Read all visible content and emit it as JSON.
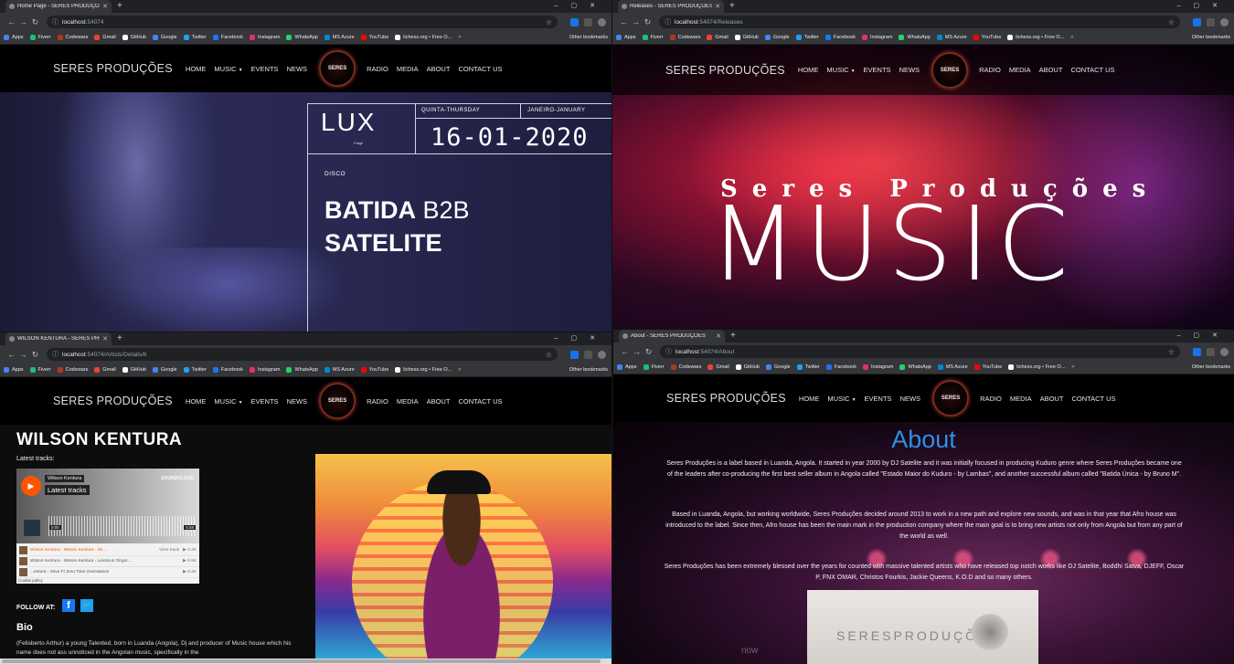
{
  "bookmarks": {
    "items": [
      "Apps",
      "Fiverr",
      "Codewars",
      "Gmail",
      "GitHub",
      "Google",
      "Twitter",
      "Facebook",
      "Instagram",
      "WhatsApp",
      "MS Azure",
      "YouTube",
      "lichess.org • Free O..."
    ],
    "overflow": "»",
    "other": "Other bookmarks",
    "colors": [
      "#4285f4",
      "#1dbf73",
      "#b1361e",
      "#ea4335",
      "#ffffff",
      "#4285f4",
      "#1da1f2",
      "#1877f2",
      "#e1306c",
      "#25d366",
      "#0089d6",
      "#ff0000",
      "#ffffff"
    ]
  },
  "site": {
    "brand": "SERES PRODUÇÕES",
    "nav_left": [
      "HOME",
      "MUSIC",
      "EVENTS",
      "NEWS"
    ],
    "nav_right": [
      "RADIO",
      "MEDIA",
      "ABOUT",
      "CONTACT US"
    ],
    "logo_text": "SERES"
  },
  "windows": {
    "home": {
      "tab_title": "Home Page - SERES PRODUÇÕES",
      "url_host": "localhost",
      "url_path": ":54074",
      "poster": {
        "venue": "LUX",
        "venue_sub": "Fragil",
        "weekday": "QUINTA-THURSDAY",
        "month": "JANEIRO-JANUARY",
        "date": "16-01-2020",
        "genre": "DISCO",
        "line1_a": "BATIDA",
        "line1_b": " B2B",
        "line2": "SATELITE"
      }
    },
    "releases": {
      "tab_title": "Releases - SERES PRODUÇÕES",
      "url_host": "localhost",
      "url_path": ":54074/Releases",
      "script_title": "Seres Produções",
      "big_title": "MUSIC"
    },
    "artist": {
      "tab_title": "WILSON KENTURA - SERES PRODUÇÕES",
      "url_host": "localhost",
      "url_path": ":54074/Artists/Details/6",
      "name": "WILSON KENTURA",
      "latest_label": "Latest tracks:",
      "soundcloud": {
        "artist": "Wilson Kentura",
        "title": "Latest tracks",
        "brand": "SOUNDCLOUD",
        "time_start": "0:00",
        "time_end": "5:58",
        "tracks": [
          {
            "name": "Wilson Kentura - Wilson Kentura - Wi...",
            "action": "View track",
            "plays": "2.2K"
          },
          {
            "name": "Wilson Kentura - Wilson Kentura - Leviticus Origin...",
            "action": "",
            "plays": "8.9K"
          },
          {
            "name": "...entura - Silva Ft Zero Toke Overalation",
            "action": "",
            "plays": "8.3K"
          }
        ],
        "cookie": "Cookie policy"
      },
      "follow_label": "FOLLOW AT:",
      "bio_title": "Bio",
      "bio_text": "(Felisberto Arthur) a young Talented, born in Luanda (Angola), Dj and producer of Music house which his name does not ass unnoticed in the Angolan music, specifically in the"
    },
    "about": {
      "tab_title": "About - SERES PRODUÇÕES",
      "url_host": "localhost",
      "url_path": ":54074/About",
      "title": "About",
      "paragraphs": [
        "Seres Produções is a label based in Luanda, Angola. It started in year 2000 by DJ Satelite and it was initially focused in producing Kuduro genre where Seres Produções became one of the leaders after co-producing the first best seller album in Angola called \"Estado Maior do Kuduro - by Lambas\", and another successful album called \"Batida Única - by Bruno M\".",
        "Based in Luanda, Angola, but working worldwide, Seres Produções decided around 2013 to work in a new path and explore new sounds, and was in that year that Afro house was introduced to the label. Since then, Afro house has been the main mark in the production company where the main goal is to bring new artists not only from Angola but from any part of the world as well.",
        "Seres Produções has been extremely blessed over the years for counted with massive talented artists who have released top notch works like DJ Satelite, Boddhi Satva, DJEFF, Oscar P, FNX OMAR, Christos Fourkis, Jackie Queens, K.O.D and so many others."
      ],
      "image_text": "SERESPRODUÇÕES",
      "watermark": "now"
    }
  }
}
